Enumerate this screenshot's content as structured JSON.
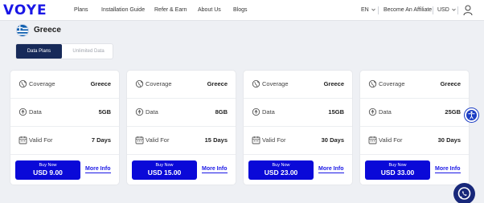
{
  "nav": {
    "logo": "VOYE",
    "links": [
      "Plans",
      "Installation Guide",
      "Refer & Earn",
      "About Us",
      "Blogs"
    ],
    "language": "EN",
    "affiliate": "Become An Affiliate",
    "currency": "USD"
  },
  "region": {
    "name": "Greece",
    "flag_colors": [
      "#0d5eaf",
      "#ffffff"
    ]
  },
  "tabs": {
    "active": "Data Plans",
    "inactive": "Unlimited Data"
  },
  "labels": {
    "coverage": "Coverage",
    "data": "Data",
    "valid_for": "Valid For",
    "buy_now": "Buy Now",
    "more_info": "More Info"
  },
  "plans": [
    {
      "coverage": "Greece",
      "data": "5GB",
      "valid_for": "7 Days",
      "price": "USD 9.00"
    },
    {
      "coverage": "Greece",
      "data": "8GB",
      "valid_for": "15 Days",
      "price": "USD 15.00"
    },
    {
      "coverage": "Greece",
      "data": "15GB",
      "valid_for": "30 Days",
      "price": "USD 23.00"
    },
    {
      "coverage": "Greece",
      "data": "25GB",
      "valid_for": "30 Days",
      "price": "USD 33.00"
    }
  ],
  "colors": {
    "brand": "#1a17e6",
    "button": "#0a09d8",
    "tab_active": "#172a59"
  },
  "icons": [
    "user-icon",
    "coverage-icon",
    "data-icon",
    "calendar-icon",
    "accessibility-icon",
    "whatsapp-icon"
  ]
}
